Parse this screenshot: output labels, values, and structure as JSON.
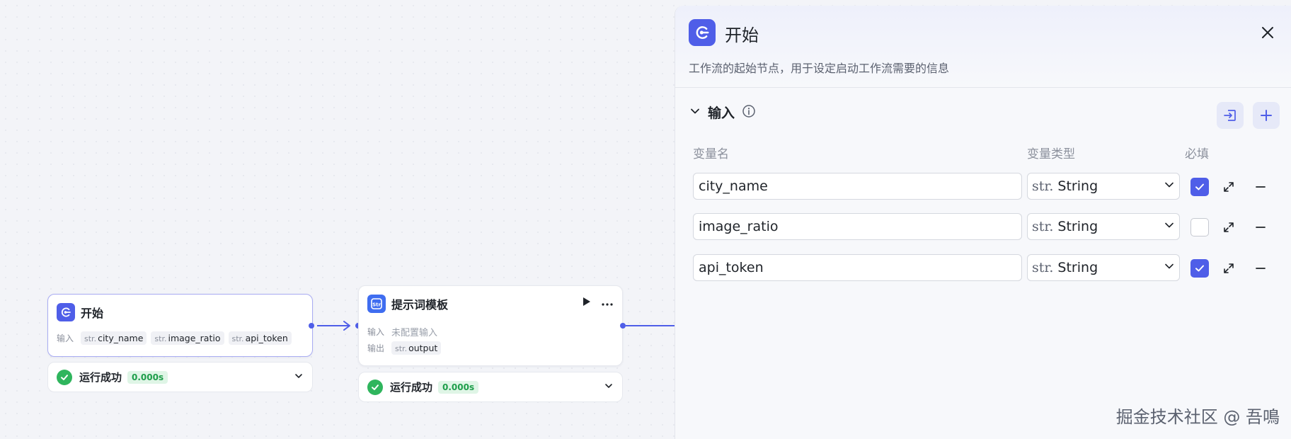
{
  "canvas": {
    "nodes": [
      {
        "title": "开始",
        "inputs_label": "输入",
        "inputs": [
          {
            "type": "str.",
            "name": "city_name"
          },
          {
            "type": "str.",
            "name": "image_ratio"
          },
          {
            "type": "str.",
            "name": "api_token"
          }
        ],
        "status": {
          "text": "运行成功",
          "time": "0.000s"
        }
      },
      {
        "title": "提示词模板",
        "inputs_label": "输入",
        "inputs_placeholder": "未配置输入",
        "outputs_label": "输出",
        "outputs": [
          {
            "type": "str.",
            "name": "output"
          }
        ],
        "status": {
          "text": "运行成功",
          "time": "0.000s"
        }
      }
    ]
  },
  "panel": {
    "title": "开始",
    "description": "工作流的起始节点，用于设定启动工作流需要的信息",
    "section_title": "输入",
    "columns": {
      "name": "变量名",
      "type": "变量类型",
      "required": "必填"
    },
    "rows": [
      {
        "name": "city_name",
        "type_prefix": "str.",
        "type": "String",
        "required": true
      },
      {
        "name": "image_ratio",
        "type_prefix": "str.",
        "type": "String",
        "required": false
      },
      {
        "name": "api_token",
        "type_prefix": "str.",
        "type": "String",
        "required": true
      }
    ]
  },
  "watermark": "掘金技术社区 @ 吾鳴",
  "colors": {
    "accent": "#4f5ee8",
    "success": "#2fb55d"
  }
}
